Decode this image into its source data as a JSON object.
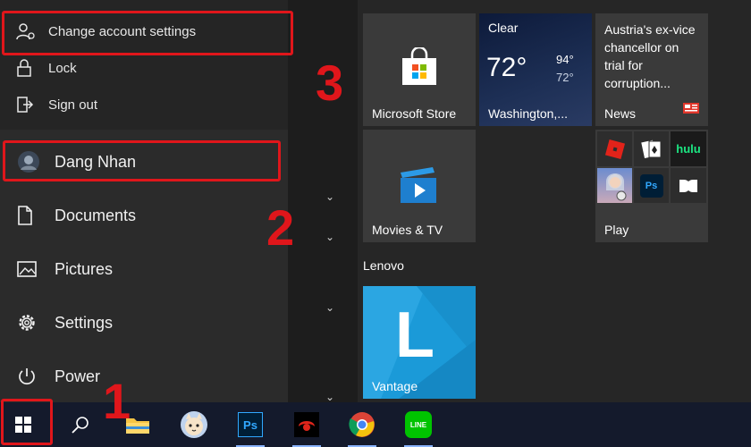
{
  "account_menu": {
    "change_settings": "Change account settings",
    "lock": "Lock",
    "sign_out": "Sign out"
  },
  "left_rail": {
    "user_name": "Dang Nhan",
    "documents": "Documents",
    "pictures": "Pictures",
    "settings": "Settings",
    "power": "Power"
  },
  "tiles": {
    "store_label": "Microsoft Store",
    "weather": {
      "condition": "Clear",
      "temp": "72°",
      "high": "94°",
      "low": "72°",
      "city": "Washington,..."
    },
    "news": {
      "headline": "Austria's ex-vice chancellor on trial for corruption...",
      "label": "News"
    },
    "movies_label": "Movies & TV",
    "play_label": "Play",
    "play_apps": {
      "hulu": "hulu",
      "ps": "Ps"
    },
    "group_lenovo": "Lenovo",
    "vantage_letter": "L",
    "vantage_label": "Vantage"
  },
  "taskbar": {
    "ps_label": "Ps",
    "line_label": "LINE"
  },
  "annotations": {
    "step1": "1",
    "step2": "2",
    "step3": "3"
  },
  "colors": {
    "annotation_red": "#e0161b",
    "vantage_blue": "#1b9ad8",
    "taskbar_bg": "#141a2c",
    "photoshop_blue": "#31a8ff"
  }
}
